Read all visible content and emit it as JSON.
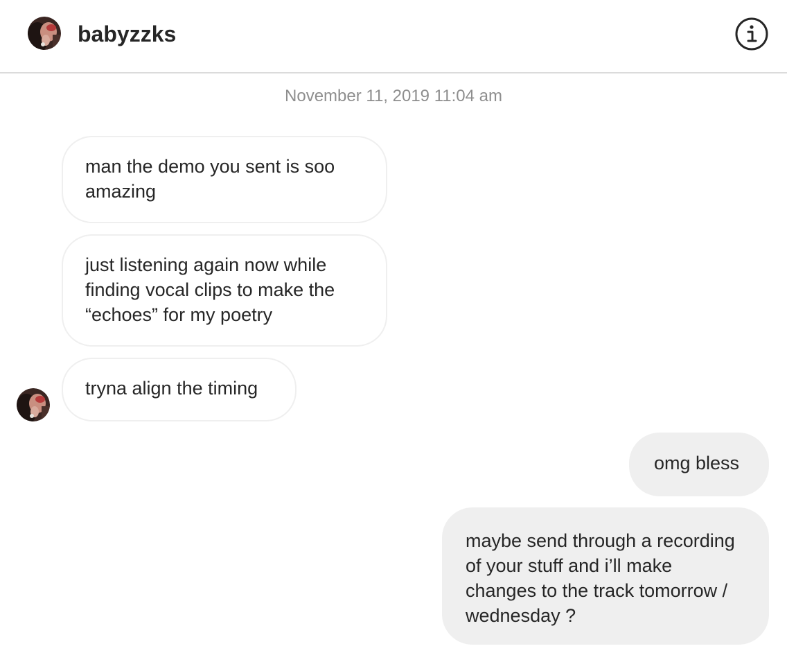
{
  "header": {
    "username": "babyzzks",
    "avatar_icon": "profile-photo-avatar",
    "info_icon": "info-circle-icon"
  },
  "thread": {
    "timestamp": "November 11, 2019 11:04 am",
    "messages": [
      {
        "direction": "incoming",
        "text": "man the demo you sent is soo amazing"
      },
      {
        "direction": "incoming",
        "text": "just listening again now while finding vocal clips to make the “echoes” for my poetry"
      },
      {
        "direction": "incoming",
        "text": "tryna align the timing"
      },
      {
        "direction": "outgoing",
        "text": "omg bless"
      },
      {
        "direction": "outgoing",
        "text": "maybe send through a recording of your stuff and i’ll make changes to the track tomorrow / wednesday ?"
      }
    ]
  },
  "colors": {
    "outgoing_bubble": "#efefef",
    "incoming_border": "#efefef",
    "timestamp_text": "#8e8e8e",
    "text": "#262626",
    "divider": "#dbdbdb"
  }
}
